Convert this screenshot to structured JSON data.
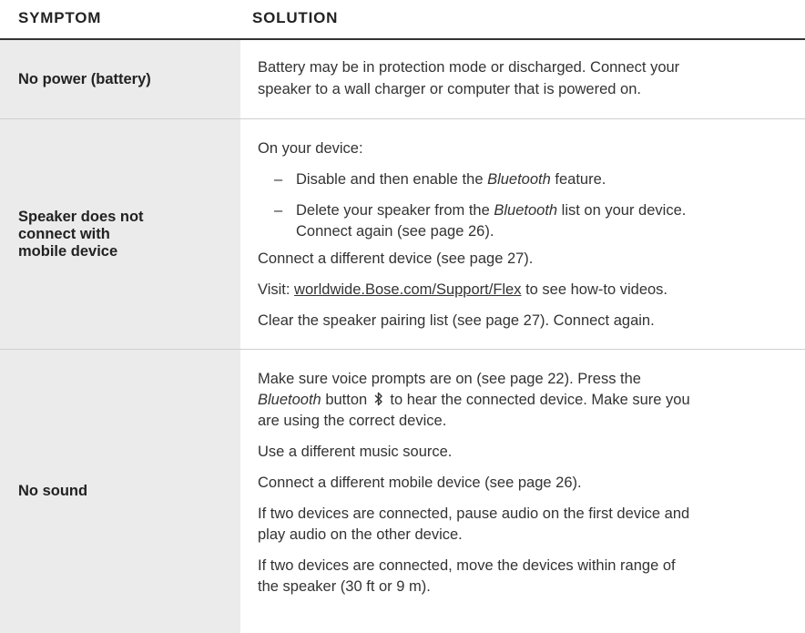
{
  "header": {
    "symptom": "SYMPTOM",
    "solution": "SOLUTION"
  },
  "rows": [
    {
      "symptom": "No power (battery)",
      "lines": [
        "Battery may be in protection mode or discharged. Connect your",
        "speaker to a wall charger or computer that is powered on."
      ]
    },
    {
      "symptom_lines": [
        "Speaker does not",
        "connect with",
        "mobile device"
      ],
      "on_device": "On your device:",
      "bullets": {
        "b1_pre": "Disable and then enable the ",
        "b1_em": "Bluetooth",
        "b1_post": " feature.",
        "b2_pre": "Delete your speaker from the ",
        "b2_em": "Bluetooth",
        "b2_post": " list on your device.",
        "b2_line2": "Connect again (see page 26)."
      },
      "connect_different": "Connect a different device (see page 27).",
      "visit_pre": "Visit: ",
      "visit_link": "worldwide.Bose.com/Support/Flex",
      "visit_post": " to see how-to videos.",
      "clear": "Clear the speaker pairing list (see page 27). Connect again."
    },
    {
      "symptom": "No sound",
      "p1_line1": "Make sure voice prompts are on (see page 22). Press the",
      "p1_line2_em": "Bluetooth",
      "p1_line2_mid": " button ",
      "p1_line2_post": " to hear the connected device. Make sure you",
      "p1_line3": "are using the correct device.",
      "music": "Use a different music source.",
      "mobile": "Connect a different mobile device (see page 26).",
      "pause_line1": "If two devices are connected, pause audio on the first device and",
      "pause_line2": "play audio on the other device.",
      "range_line1": "If two devices are connected, move the devices within range of",
      "range_line2": "the speaker (30 ft or 9 m)."
    }
  ],
  "icons": {
    "bluetooth": "bluetooth-icon"
  },
  "colors": {
    "text": "#333333",
    "symptom_bg": "#ebebeb",
    "rule": "#333333"
  }
}
